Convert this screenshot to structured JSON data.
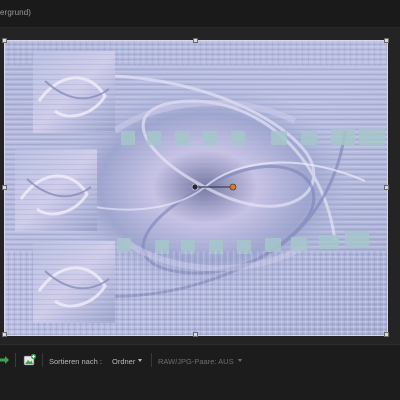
{
  "header": {
    "partial_label": "ergrund)"
  },
  "status_bar": {
    "sort_label": "Sortieren nach :",
    "sort_value": "Ordner",
    "raw_jpg_label": "RAW/JPG-Paare: AUS"
  },
  "icons": {
    "arrow": "arrow-right-icon",
    "photo_add": "photo-add-icon",
    "sort_dropdown": "chevron-down-icon",
    "raw_dropdown": "chevron-down-icon",
    "transform_center": "pivot-icon",
    "rotate_handle": "rotate-handle-icon"
  },
  "colors": {
    "canvas_base": "#a9b0d3",
    "accent_orange": "#d67a2a",
    "photo_icon_green": "#37a84a"
  }
}
